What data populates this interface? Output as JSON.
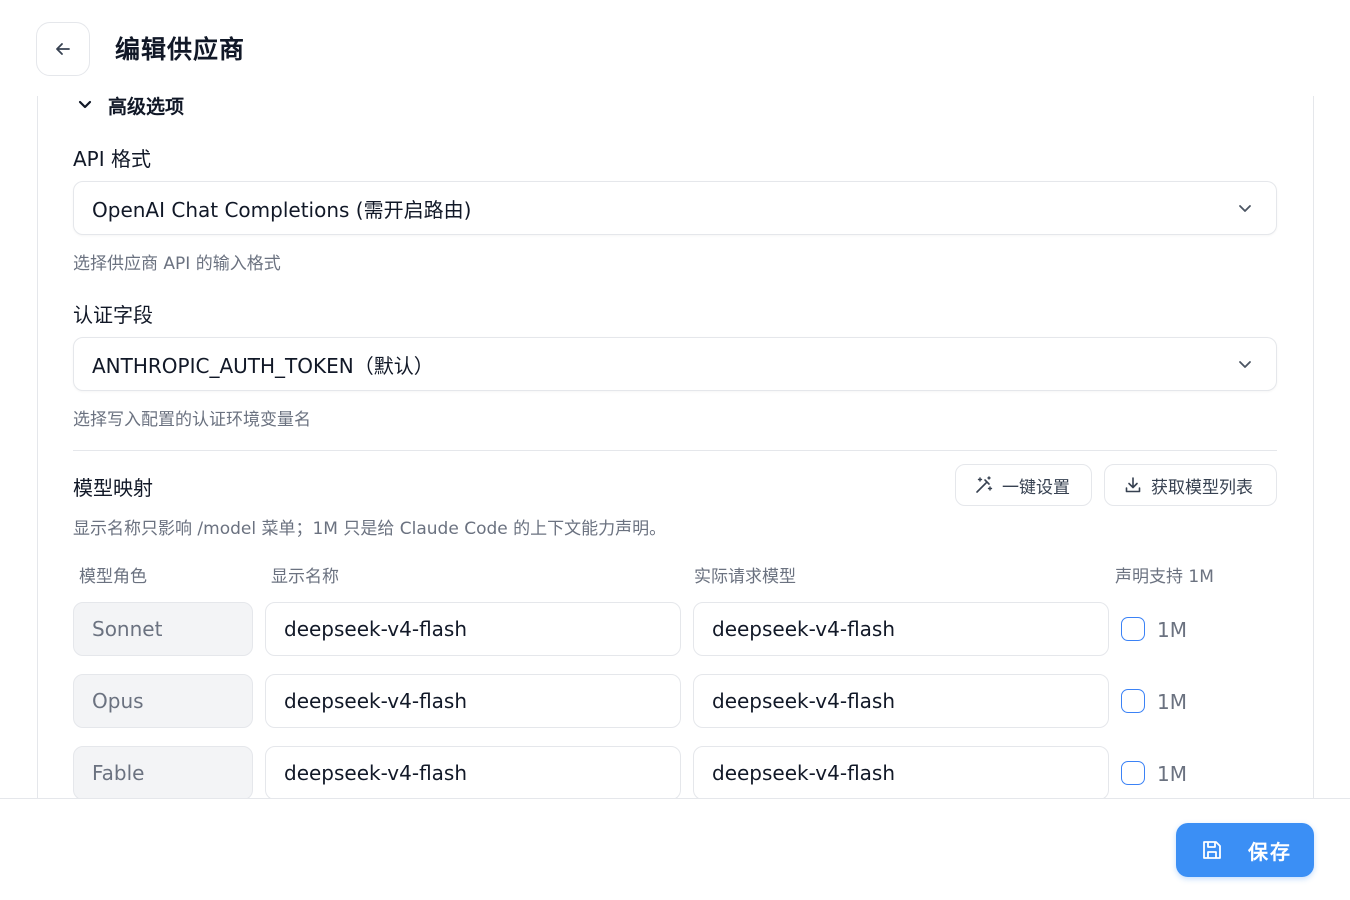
{
  "header": {
    "title": "编辑供应商"
  },
  "advanced": {
    "toggle_label": "高级选项"
  },
  "api_format": {
    "label": "API 格式",
    "value": "OpenAI Chat Completions (需开启路由)",
    "help": "选择供应商 API 的输入格式"
  },
  "auth_field": {
    "label": "认证字段",
    "value": "ANTHROPIC_AUTH_TOKEN（默认）",
    "help": "选择写入配置的认证环境变量名"
  },
  "model_mapping": {
    "title": "模型映射",
    "quick_setup_label": "一键设置",
    "fetch_models_label": "获取模型列表",
    "description": "显示名称只影响 /model 菜单；1M 只是给 Claude Code 的上下文能力声明。",
    "columns": [
      "模型角色",
      "显示名称",
      "实际请求模型",
      "声明支持 1M"
    ],
    "rows": [
      {
        "role": "Sonnet",
        "display_name": "deepseek-v4-flash",
        "request_model": "deepseek-v4-flash",
        "supports_1m": false,
        "check_label": "1M"
      },
      {
        "role": "Opus",
        "display_name": "deepseek-v4-flash",
        "request_model": "deepseek-v4-flash",
        "supports_1m": false,
        "check_label": "1M"
      },
      {
        "role": "Fable",
        "display_name": "deepseek-v4-flash",
        "request_model": "deepseek-v4-flash",
        "supports_1m": false,
        "check_label": "1M"
      }
    ]
  },
  "footer": {
    "save_label": "保存"
  },
  "icons": {
    "back": "arrow-left-icon",
    "toggle": "chevron-down-icon",
    "select": "chevron-down-icon",
    "quick_setup": "magic-wand-icon",
    "fetch": "download-icon",
    "save": "floppy-disk-icon"
  },
  "colors": {
    "accent": "#3b8ff5",
    "checkbox_border": "#3b82f6",
    "muted_text": "#6b7280",
    "border": "#e5e7eb"
  }
}
